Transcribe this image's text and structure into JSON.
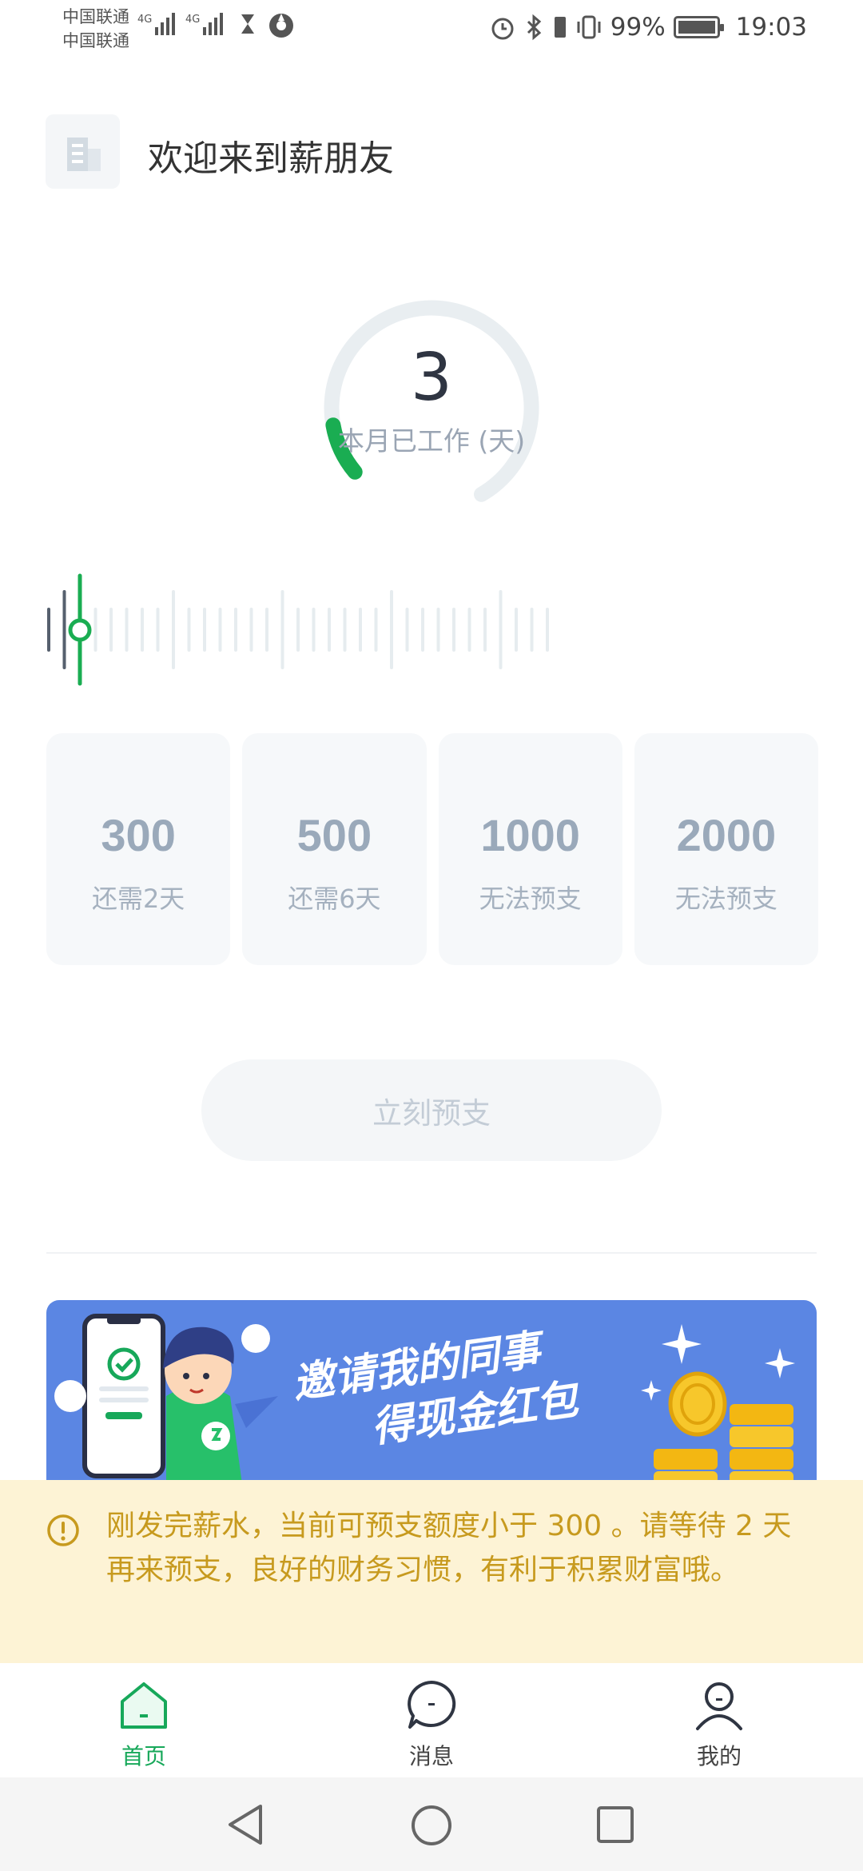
{
  "status_bar": {
    "carrier_1": "中国联通",
    "carrier_2": "中国联通",
    "network_1": "4G",
    "network_2": "4G",
    "battery_percent": "99%",
    "battery_level": 0.99,
    "time": "19:03"
  },
  "header": {
    "welcome_text": "欢迎来到薪朋友",
    "logo_icon": "building-icon"
  },
  "gauge": {
    "value": "3",
    "label": "本月已工作 (天)",
    "progress": 0.1,
    "colors": {
      "track": "#e9eef1",
      "progress": "#1aad52"
    }
  },
  "ruler": {
    "current_day": 3,
    "total_ticks": 33,
    "colors": {
      "passed": "#56606e",
      "marker": "#1aad52",
      "future": "#e6ecef"
    }
  },
  "amount_options": [
    {
      "amount": "300",
      "note": "还需2天"
    },
    {
      "amount": "500",
      "note": "还需6天"
    },
    {
      "amount": "1000",
      "note": "无法预支"
    },
    {
      "amount": "2000",
      "note": "无法预支"
    }
  ],
  "advance_button": {
    "label": "立刻预支",
    "enabled": false
  },
  "banner": {
    "line_1": "邀请我的同事",
    "line_2": "得现金红包",
    "background": "#5b86e3"
  },
  "notice": {
    "icon": "exclamation-circle-icon",
    "text": "刚发完薪水，当前可预支额度小于 300 。请等待 2 天再来预支，良好的财务习惯，有利于积累财富哦。",
    "color": "#c79a1e"
  },
  "tabs": [
    {
      "label": "首页",
      "icon": "home-icon",
      "active": true
    },
    {
      "label": "消息",
      "icon": "message-icon",
      "active": false
    },
    {
      "label": "我的",
      "icon": "profile-icon",
      "active": false
    }
  ],
  "nav": {
    "back": "back-icon",
    "home": "home-circle-icon",
    "recents": "recents-icon"
  }
}
